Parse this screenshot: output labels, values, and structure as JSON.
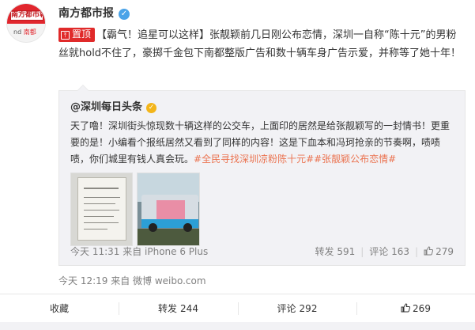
{
  "colors": {
    "brand_red": "#e1262d",
    "topic_orange": "#eb7350",
    "verify_blue": "#4aa3e8",
    "verify_gold": "#f3b51a",
    "muted_gray": "#808080"
  },
  "post": {
    "author": "南方都市报",
    "author_verified_icon": "check-icon",
    "avatar": {
      "logo_text": "南方都市報",
      "sub_prefix": "nd",
      "sub_brand": "南都"
    },
    "pin_label": "置顶",
    "text": "【霸气！追星可以这样】张靓颖前几日刚公布恋情，深圳一自称“陈十元”的男粉丝就hold不住了，豪掷千金包下南都整版广告和数十辆车身广告示爱，并称等了她十年！",
    "time": "今天 12:19 来自 微博 weibo.com"
  },
  "quoted": {
    "author": "@深圳每日头条",
    "text": "天了噜！深圳街头惊现数十辆这样的公交车，上面印的居然是给张靓颖写的一封情书！更重要的是！小编看个报纸居然又看到了同样的内容！这是下血本和冯珂抢亲的节奏啊，啧啧啧，你们城里有钱人真会玩。",
    "topics": "#全民寻找深圳凉粉陈十元##张靓颖公布恋情#",
    "time": "今天 11:31 来自 iPhone 6 Plus",
    "repost_label": "转发",
    "repost_count": "591",
    "comment_label": "评论",
    "comment_count": "163",
    "like_count": "279"
  },
  "actions": {
    "favorite_label": "收藏",
    "repost_label": "转发",
    "repost_count": "244",
    "comment_label": "评论",
    "comment_count": "292",
    "like_count": "269"
  }
}
